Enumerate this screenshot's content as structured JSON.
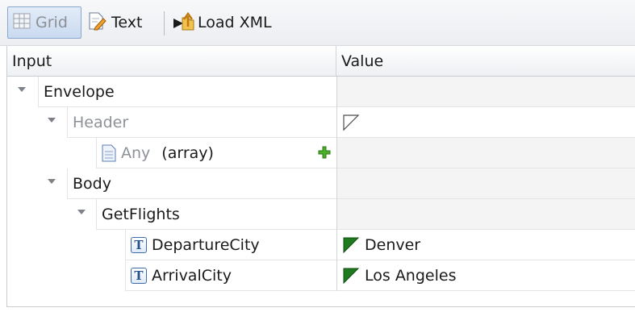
{
  "toolbar": {
    "grid_label": "Grid",
    "text_label": "Text",
    "load_xml_label": "Load XML"
  },
  "grid": {
    "columns": {
      "input": "Input",
      "value": "Value"
    },
    "rows": [
      {
        "label": "Envelope",
        "value": ""
      },
      {
        "label": "Header",
        "value": ""
      },
      {
        "label": "Any",
        "type_note": "(array)",
        "value": ""
      },
      {
        "label": "Body",
        "value": ""
      },
      {
        "label": "GetFlights",
        "value": ""
      },
      {
        "label": "DepartureCity",
        "type_icon": "T",
        "value": "Denver"
      },
      {
        "label": "ArrivalCity",
        "type_icon": "T",
        "value": "Los Angeles"
      }
    ]
  },
  "colors": {
    "selected_button": "#c9daf0",
    "value_flag_green": "#1f7a1f",
    "add_plus_green": "#4caf29"
  },
  "icons": [
    "grid-icon",
    "text-edit-icon",
    "load-xml-icon",
    "expand-arrow-icon",
    "document-icon",
    "add-icon",
    "text-type-icon",
    "value-set-flag-icon",
    "empty-value-flag-icon"
  ]
}
